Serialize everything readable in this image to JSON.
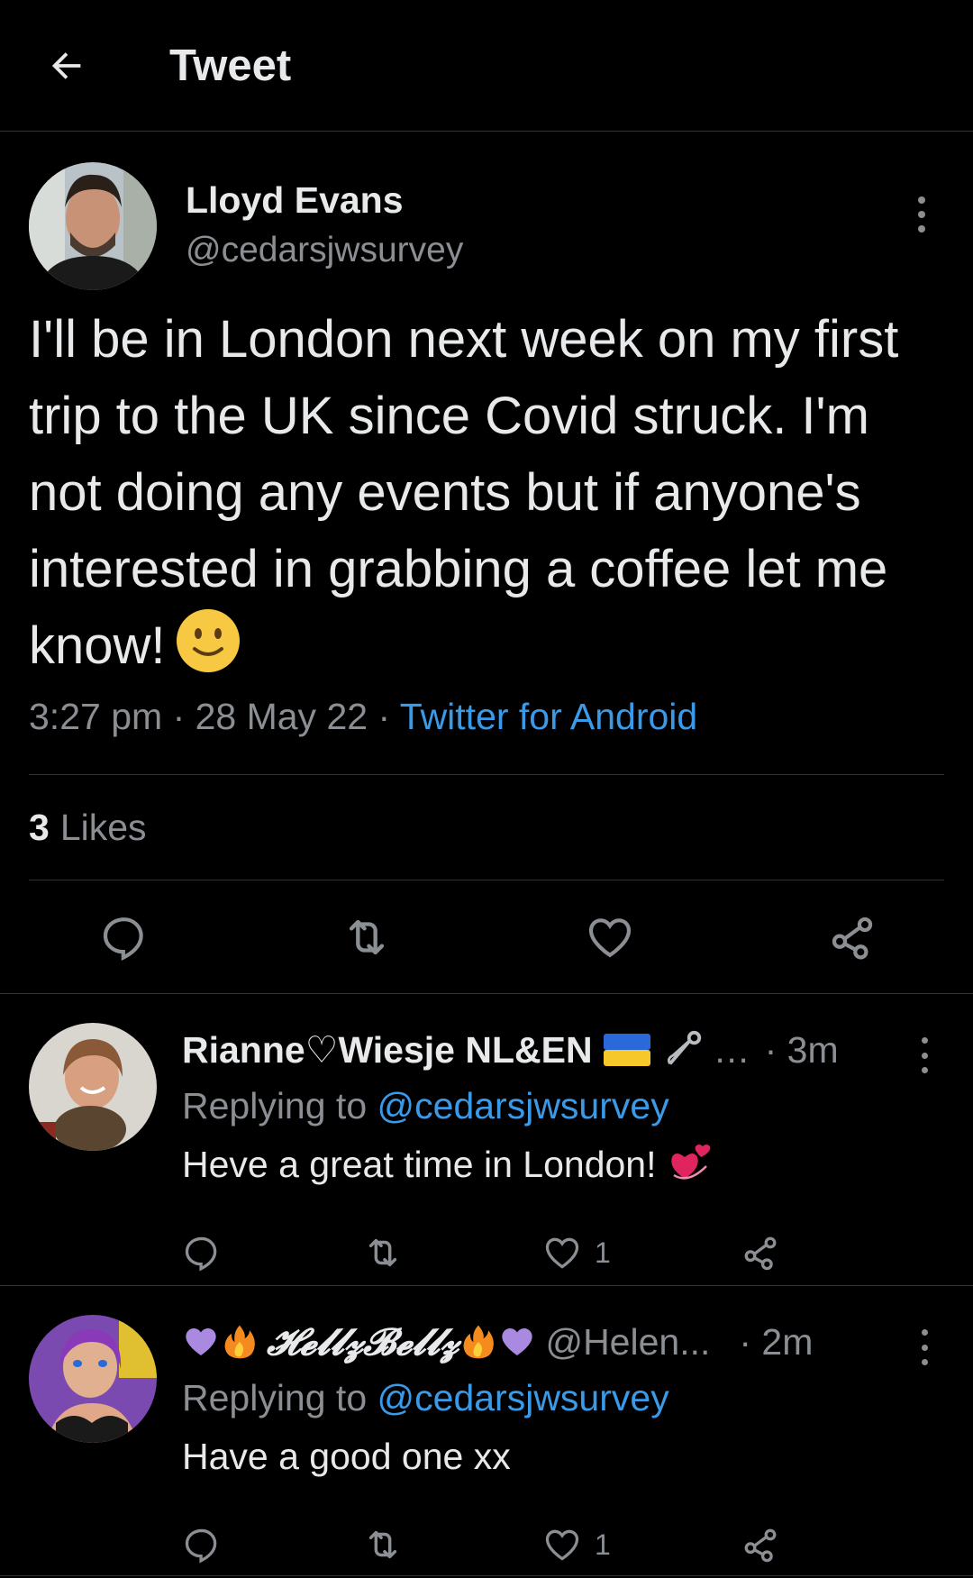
{
  "header": {
    "title": "Tweet",
    "back_icon": "arrow-left-icon"
  },
  "tweet": {
    "author_name": "Lloyd Evans",
    "author_handle": "@cedarsjwsurvey",
    "text": "I'll be in London next week on my first trip to the UK since Covid struck. I'm not doing any events but if anyone's interested in grabbing a coffee let me know!",
    "emoji": "slightly-smiling-face",
    "time": "3:27 pm",
    "date": "28 May 22",
    "source": "Twitter for Android",
    "likes_count": "3",
    "likes_label": "Likes"
  },
  "replies": [
    {
      "name": "Rianne♡Wiesje NL&EN",
      "name_suffix": "…",
      "time": "· 3m",
      "replying_prefix": "Replying to",
      "replying_to": "@cedarsjwsurvey",
      "text": "Heve a great time in London!",
      "like_count": ""
    },
    {
      "name": "𝓗𝓮𝓵𝓵𝔃𝓑𝓮𝓵𝓵𝔃",
      "handle": "@Helen...",
      "time": "· 2m",
      "replying_prefix": "Replying to",
      "replying_to": "@cedarsjwsurvey",
      "text": "Have a good one xx",
      "like_count": "1"
    }
  ],
  "reply1_like_count": "1",
  "colors": {
    "background": "#000000",
    "link": "#3b9ae8",
    "muted": "#8b8f94",
    "divider": "#2f3336"
  }
}
